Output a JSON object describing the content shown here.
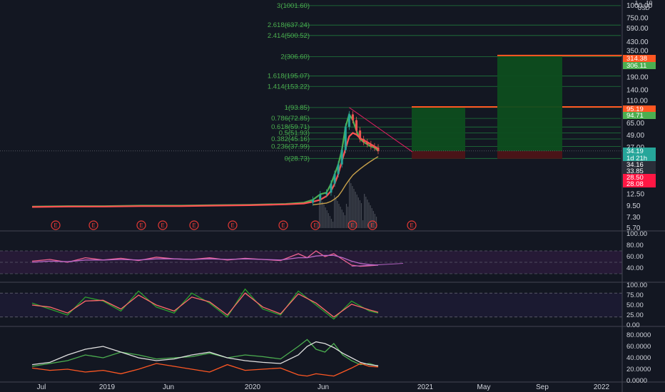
{
  "colors": {
    "background": "#131722",
    "panel_divider": "#434651",
    "text": "#d1d4dc",
    "fib_line": "#1f7a3c",
    "fib_text": "#4caf50",
    "long_profit": "#0d4d1f",
    "long_loss": "#4d1418",
    "entry_line": "#ff5722",
    "ema_fast": "#4caf50",
    "ema_slow": "#ff5252",
    "ma_long": "#c9a24b",
    "candle_up": "#26a69a",
    "candle_down": "#ef5350",
    "volume": "#6b6f7a",
    "earnings_badge": "#e53935",
    "rsi_line": "#f06292",
    "rsi_ma": "#ba68c8",
    "stoch_k": "#2ca02c",
    "stoch_d": "#ff6b6b",
    "dmi_plus": "#4caf50",
    "dmi_minus": "#ff5722",
    "adx": "#e0e0e0"
  },
  "price_axis": {
    "currency_label": "USD",
    "scale_label": "1 ... 10",
    "ticks": [
      "1000.00",
      "750.00",
      "590.00",
      "430.00",
      "350.00",
      "250.00",
      "190.00",
      "140.00",
      "110.00",
      "85.00",
      "65.00",
      "49.00",
      "37.00",
      "27.00",
      "16.40",
      "12.50",
      "9.50",
      "7.30",
      "5.70"
    ],
    "badges": [
      {
        "text": "314.38",
        "color": "#ff5722"
      },
      {
        "text": "306.11",
        "color": "#4caf50"
      },
      {
        "text": "95.19",
        "color": "#ff5722"
      },
      {
        "text": "94.71",
        "color": "#4caf50"
      },
      {
        "text": "34.19",
        "color": "#26a69a"
      },
      {
        "text": "1d 21h",
        "color": "#26a69a"
      },
      {
        "text": "34.16",
        "color": "#2a2e39"
      },
      {
        "text": "33.85",
        "color": "#2a2e39"
      },
      {
        "text": "28.50",
        "color": "#ff1744"
      },
      {
        "text": "28.08",
        "color": "#ff1744"
      }
    ]
  },
  "time_axis": {
    "labels": [
      "Jul",
      "2019",
      "Jun",
      "2020",
      "Jun",
      "2021",
      "May",
      "Sep",
      "2022"
    ]
  },
  "earnings": {
    "label": "E",
    "count": 11
  },
  "chart_data": [
    {
      "type": "line",
      "panel": "price",
      "scale": "log",
      "ylim": [
        5.7,
        1000
      ],
      "x": [
        0,
        40,
        80,
        120,
        160,
        200,
        240,
        280,
        300,
        310,
        318,
        325,
        330,
        334,
        338,
        342,
        346,
        350,
        354,
        358,
        362,
        366,
        370,
        374,
        378,
        382
      ],
      "series": [
        {
          "values": [
            9.4,
            9.5,
            9.5,
            9.6,
            9.6,
            9.7,
            9.8,
            10.0,
            10.3,
            11.0,
            12.5,
            13.0,
            16.0,
            20.0,
            25.0,
            35.0,
            60.0,
            80.0,
            70.0,
            55.0,
            45.0,
            42.0,
            40.0,
            38.0,
            37.0,
            34.19
          ]
        },
        {
          "values": [
            9.3,
            9.4,
            9.4,
            9.5,
            9.5,
            9.6,
            9.7,
            9.9,
            10.1,
            10.5,
            11.0,
            12.0,
            13.5,
            16.0,
            20.0,
            27.0,
            36.0,
            48.0,
            52.0,
            50.0,
            46.0,
            44.0,
            42.0,
            40.0,
            38.0,
            36.0
          ]
        },
        {
          "values": [
            null,
            null,
            null,
            null,
            null,
            null,
            null,
            null,
            null,
            9.8,
            10.0,
            10.2,
            10.6,
            11.2,
            12.0,
            13.5,
            15.5,
            17.5,
            19.5,
            21.0,
            22.5,
            24.0,
            25.5,
            27.0,
            28.5,
            30.0
          ]
        }
      ],
      "fib_levels": [
        {
          "label": "3(1001.60)",
          "value": 1001.6
        },
        {
          "label": "2.618(637.24)",
          "value": 637.24
        },
        {
          "label": "2.414(500.52)",
          "value": 500.52
        },
        {
          "label": "2(306.60)",
          "value": 306.6
        },
        {
          "label": "1.618(195.07)",
          "value": 195.07
        },
        {
          "label": "1.414(153.22)",
          "value": 153.22
        },
        {
          "label": "1(93.85)",
          "value": 93.85
        },
        {
          "label": "0.786(72.85)",
          "value": 72.85
        },
        {
          "label": "0.618(59.71)",
          "value": 59.71
        },
        {
          "label": "0.5(51.93)",
          "value": 51.93
        },
        {
          "label": "0.382(45.16)",
          "value": 45.16
        },
        {
          "label": "0.236(37.99)",
          "value": 37.99
        },
        {
          "label": "0(28.73)",
          "value": 28.73
        }
      ],
      "positions": [
        {
          "target": 95.19,
          "entry": 34.16,
          "stop": 28.5
        },
        {
          "target": 314.38,
          "entry": 34.16,
          "stop": 28.5
        }
      ]
    },
    {
      "type": "line",
      "panel": "rsi",
      "ylim": [
        20,
        100
      ],
      "ticks": [
        "100.00",
        "80.00",
        "60.00",
        "40.00"
      ],
      "bands": [
        70,
        50,
        30
      ],
      "x": [
        0,
        20,
        40,
        60,
        80,
        100,
        120,
        140,
        160,
        180,
        200,
        220,
        240,
        260,
        280,
        300,
        310,
        320,
        330,
        340,
        350,
        360,
        370,
        380,
        390
      ],
      "series": [
        {
          "values": [
            52,
            55,
            50,
            58,
            54,
            57,
            53,
            59,
            56,
            55,
            58,
            54,
            57,
            55,
            53,
            65,
            58,
            70,
            60,
            65,
            55,
            45,
            43,
            44,
            45
          ]
        },
        {
          "values": [
            50,
            52,
            51,
            54,
            54,
            55,
            54,
            56,
            56,
            55,
            56,
            55,
            56,
            55,
            54,
            58,
            58,
            61,
            62,
            62,
            58,
            52,
            48,
            46,
            45
          ]
        }
      ]
    },
    {
      "type": "line",
      "panel": "stoch",
      "ylim": [
        0,
        100
      ],
      "ticks": [
        "100.00",
        "75.00",
        "50.00",
        "25.00",
        "0.00"
      ],
      "bands": [
        80,
        20
      ],
      "x": [
        0,
        20,
        40,
        60,
        80,
        100,
        120,
        140,
        160,
        180,
        200,
        220,
        240,
        260,
        280,
        300,
        320,
        340,
        360,
        380,
        390
      ],
      "series": [
        {
          "values": [
            55,
            40,
            25,
            70,
            60,
            35,
            85,
            45,
            30,
            80,
            55,
            20,
            90,
            40,
            25,
            85,
            50,
            15,
            60,
            35,
            30
          ]
        },
        {
          "values": [
            50,
            45,
            30,
            60,
            62,
            40,
            75,
            50,
            35,
            70,
            58,
            25,
            80,
            45,
            28,
            78,
            55,
            20,
            52,
            38,
            32
          ]
        }
      ]
    },
    {
      "type": "line",
      "panel": "dmi",
      "ylim": [
        0,
        90
      ],
      "ticks": [
        "80.0000",
        "60.0000",
        "40.0000",
        "20.0000",
        "0.0000"
      ],
      "x": [
        0,
        20,
        40,
        60,
        80,
        100,
        120,
        140,
        160,
        180,
        200,
        220,
        240,
        260,
        280,
        300,
        310,
        320,
        330,
        340,
        350,
        360,
        370,
        380,
        390
      ],
      "series": [
        {
          "values": [
            25,
            30,
            35,
            45,
            40,
            50,
            45,
            38,
            40,
            42,
            48,
            40,
            45,
            42,
            38,
            60,
            72,
            55,
            50,
            65,
            45,
            35,
            28,
            30,
            25
          ]
        },
        {
          "values": [
            22,
            18,
            20,
            15,
            18,
            12,
            20,
            30,
            25,
            20,
            15,
            28,
            18,
            20,
            22,
            10,
            8,
            12,
            10,
            8,
            15,
            22,
            30,
            25,
            24
          ]
        },
        {
          "values": [
            28,
            32,
            45,
            55,
            60,
            50,
            40,
            35,
            38,
            45,
            50,
            40,
            35,
            32,
            30,
            45,
            60,
            68,
            65,
            58,
            48,
            40,
            32,
            28,
            26
          ]
        }
      ]
    }
  ]
}
